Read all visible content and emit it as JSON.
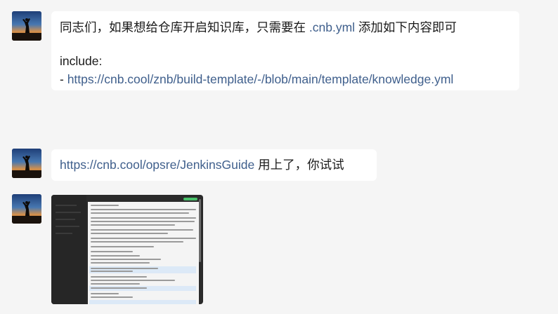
{
  "messages": [
    {
      "line1_text": "同志们，如果想给仓库开启知识库，只需要在 ",
      "line1_link": ".cnb.yml",
      "line1_suffix": " 添加如下内容即可",
      "line2": "include:",
      "line3_prefix": "- ",
      "line3_link": "https://cnb.cool/znb/build-template/-/blob/main/template/knowledge.yml"
    },
    {
      "link": "https://cnb.cool/opsre/JenkinsGuide",
      "suffix": " 用上了，你试试"
    }
  ],
  "colors": {
    "background": "#f5f5f5",
    "bubble": "#ffffff",
    "link": "#3f5f8c",
    "text": "#1a1a1a"
  }
}
